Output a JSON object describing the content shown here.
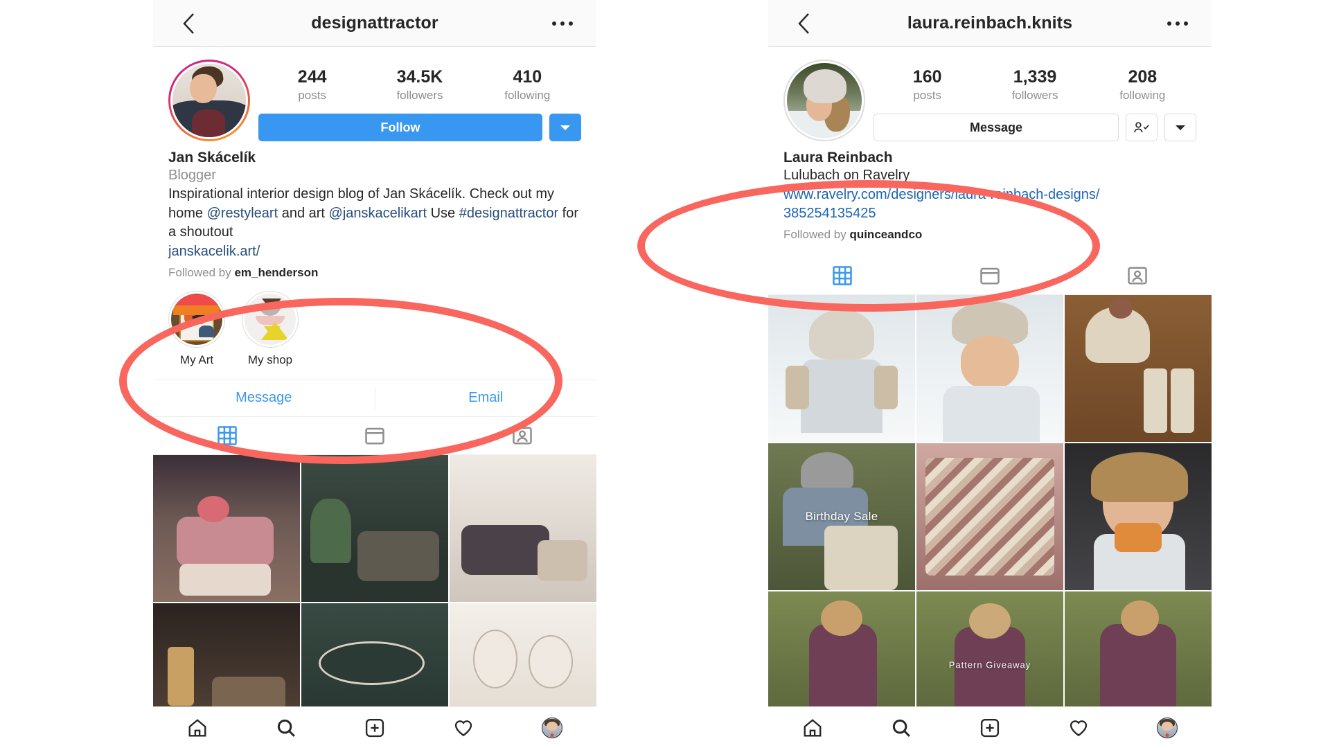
{
  "panels": [
    {
      "id": "left",
      "nav": {
        "title": "designattractor",
        "back_icon": "chevron-left-icon",
        "more_icon": "more-options-icon"
      },
      "stats": [
        {
          "num": "244",
          "label": "posts"
        },
        {
          "num": "34.5K",
          "label": "followers"
        },
        {
          "num": "410",
          "label": "following"
        }
      ],
      "actions": {
        "primary": "Follow",
        "primary_style": "#3897f0",
        "dropdown_icon": "chevron-down-icon"
      },
      "bio": {
        "name": "Jan Skácelík",
        "category": "Blogger",
        "desc_1": "Inspirational interior design blog of Jan Skácelík. Check out",
        "desc_2_a": "my home ",
        "mention_1": "@restyleart",
        "desc_2_b": " and art ",
        "mention_2": "@janskacelikart",
        "desc_2_c": "  Use",
        "hashtag": "#designattractor",
        "desc_3": " for a shoutout",
        "url": "janskacelik.art/",
        "followed_prefix": "Followed by ",
        "followed_name": "em_henderson"
      },
      "highlights": [
        {
          "label": "My Art"
        },
        {
          "label": "My shop"
        }
      ],
      "contact_buttons": [
        "Message",
        "Email"
      ],
      "tabs": [
        {
          "icon": "grid-icon",
          "active": true
        },
        {
          "icon": "tv-icon",
          "active": false
        },
        {
          "icon": "tagged-person-icon",
          "active": false
        }
      ],
      "grid_overlays": []
    },
    {
      "id": "right",
      "nav": {
        "title": "laura.reinbach.knits",
        "back_icon": "chevron-left-icon",
        "more_icon": "more-options-icon"
      },
      "stats": [
        {
          "num": "160",
          "label": "posts"
        },
        {
          "num": "1,339",
          "label": "followers"
        },
        {
          "num": "208",
          "label": "following"
        }
      ],
      "actions": {
        "primary": "Message",
        "primary_style": "#ffffff",
        "following_icon": "person-check-icon",
        "dropdown_icon": "chevron-down-icon"
      },
      "bio": {
        "name": "Laura Reinbach",
        "category": "Lulubach on Ravelry",
        "url_line_1": "www.ravelry.com/designers/laura-reinbach-designs/",
        "url_line_2": "385254135425",
        "followed_prefix": "Followed by ",
        "followed_name": "quinceandco"
      },
      "highlights": [],
      "contact_buttons": [],
      "tabs": [
        {
          "icon": "grid-icon",
          "active": true
        },
        {
          "icon": "tv-icon",
          "active": false
        },
        {
          "icon": "tagged-person-icon",
          "active": false
        }
      ],
      "grid_overlays": [
        "Birthday Sale",
        "Pattern Giveaway"
      ]
    }
  ],
  "tabbar": {
    "items": [
      {
        "icon": "home-icon"
      },
      {
        "icon": "search-icon"
      },
      {
        "icon": "add-post-icon"
      },
      {
        "icon": "heart-icon"
      },
      {
        "icon": "profile-avatar-icon"
      }
    ]
  },
  "annotation": {
    "color": "#f9665e",
    "shape": "ellipse",
    "count": 2
  }
}
